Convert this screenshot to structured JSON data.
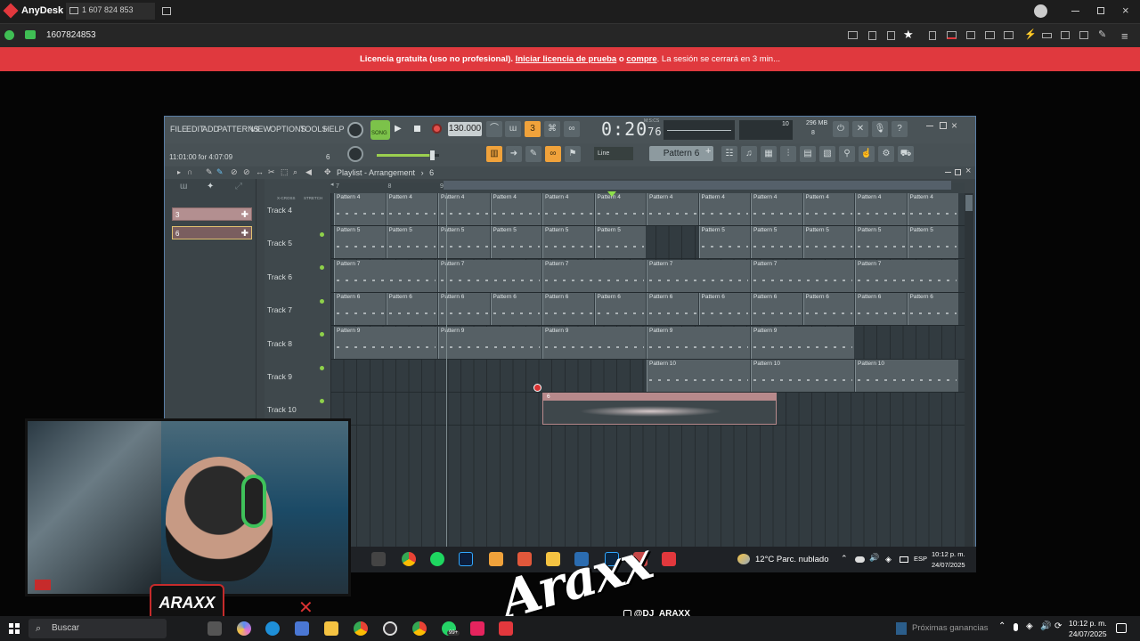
{
  "anydesk": {
    "app_name": "AnyDesk",
    "session_tab": "1 607 824 853",
    "address": "1607824853",
    "banner": {
      "lead": "Licencia gratuita (uso no profesional).",
      "link1": "Iniciar licencia de prueba",
      "mid": "o",
      "link2": "compre",
      "tail": ". La sesión se cerrará en 3 min..."
    }
  },
  "fl": {
    "menu": [
      "FILE",
      "EDIT",
      "ADD",
      "PATTERNS",
      "VIEW",
      "OPTIONS",
      "TOOLS",
      "HELP"
    ],
    "song_label": "SONG",
    "bpm": "130.000",
    "time_main": "0:20",
    "time_sub": "76",
    "time_unit": "M:S:CS",
    "cpu_value": "10",
    "mem_value": "296 MB",
    "mem_sub": "8",
    "info": "11:01:00 for 4:07:09",
    "info_extra": "6",
    "snap": "Line",
    "pattern": "Pattern 6",
    "playlist_title": "Playlist - Arrangement",
    "playlist_sep": "›",
    "playlist_pattern": "6",
    "ruler": [
      "7",
      "8",
      "9",
      "10",
      "11",
      "12",
      "13",
      "14",
      "15",
      "16",
      "17",
      "18"
    ],
    "pickers": [
      "3",
      "6"
    ],
    "tracks": [
      "Track 4",
      "Track 5",
      "Track 6",
      "Track 7",
      "Track 8",
      "Track 9",
      "Track 10"
    ],
    "lanes": [
      {
        "clips": [
          {
            "label": "Pattern 4"
          },
          {
            "label": "Pattern 4"
          },
          {
            "label": "Pattern 4"
          },
          {
            "label": "Pattern 4"
          },
          {
            "label": "Pattern 4"
          },
          {
            "label": "Pattern 4"
          },
          {
            "label": "Pattern 4"
          },
          {
            "label": "Pattern 4"
          },
          {
            "label": "Pattern 4"
          },
          {
            "label": "Pattern 4"
          },
          {
            "label": "Pattern 4"
          },
          {
            "label": "Pattern 4"
          }
        ]
      },
      {
        "clips": [
          {
            "label": "Pattern 5"
          },
          {
            "label": "Pattern 5"
          },
          {
            "label": "Pattern 5"
          },
          {
            "label": "Pattern 5"
          },
          {
            "label": "Pattern 5"
          },
          {
            "label": "Pattern 5"
          },
          {
            "label": "Pattern 5"
          },
          {
            "label": "Pattern 5"
          },
          {
            "label": "Pattern 5"
          },
          {
            "label": "Pattern 5"
          },
          {
            "label": "Pattern 5"
          }
        ]
      },
      {
        "clips": [
          {
            "label": "Pattern 7"
          },
          {
            "label": "Pattern 7"
          },
          {
            "label": "Pattern 7"
          },
          {
            "label": "Pattern 7"
          },
          {
            "label": "Pattern 7"
          },
          {
            "label": "Pattern 7"
          }
        ]
      },
      {
        "clips": [
          {
            "label": "Pattern 6"
          },
          {
            "label": "Pattern 6"
          },
          {
            "label": "Pattern 6"
          },
          {
            "label": "Pattern 6"
          },
          {
            "label": "Pattern 6"
          },
          {
            "label": "Pattern 6"
          },
          {
            "label": "Pattern 6"
          },
          {
            "label": "Pattern 6"
          },
          {
            "label": "Pattern 6"
          },
          {
            "label": "Pattern 6"
          },
          {
            "label": "Pattern 6"
          },
          {
            "label": "Pattern 6"
          }
        ]
      },
      {
        "clips": [
          {
            "label": "Pattern 9"
          },
          {
            "label": "Pattern 9"
          },
          {
            "label": "Pattern 9"
          },
          {
            "label": "Pattern 9"
          },
          {
            "label": "Pattern 9"
          }
        ]
      },
      {
        "clips": [
          {
            "label": "Pattern 10"
          },
          {
            "label": "Pattern 10"
          },
          {
            "label": "Pattern 10"
          }
        ]
      },
      {
        "audio": {
          "label": "6"
        }
      }
    ]
  },
  "remote_taskbar": {
    "weather": "12°C  Parc. nublado",
    "lang": "ESP",
    "time": "10:12 p. m.",
    "date": "24/07/2025"
  },
  "overlay": {
    "badge": "ARAXX",
    "signature": "Araxx",
    "handle": "@DJ_ARAXX"
  },
  "local_taskbar": {
    "search": "Buscar",
    "notice": "Próximas ganancias",
    "time": "10:12 p. m.",
    "date": "24/07/2025",
    "badge": "99+"
  },
  "colors": {
    "banner": "#e0393e",
    "fl_accent": "#f0a23b",
    "led_green": "#8fd14a",
    "audio_clip": "#b7898b"
  }
}
